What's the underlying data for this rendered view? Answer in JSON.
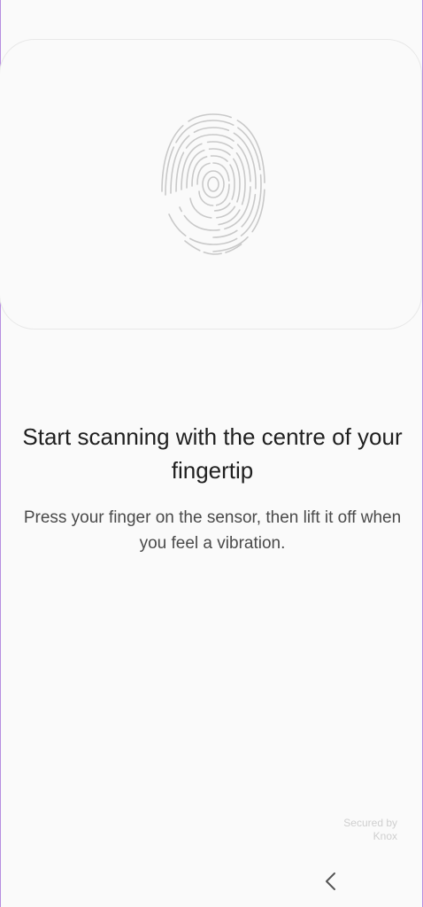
{
  "scan_card": {
    "icon": "fingerprint-icon"
  },
  "instructions": {
    "title": "Start scanning with the centre of your fingertip",
    "description": "Press your finger on the sensor, then lift it off when you feel a vibration."
  },
  "security": {
    "line1": "Secured by",
    "line2": "Knox"
  },
  "nav": {
    "back_icon": "chevron-left-icon"
  }
}
